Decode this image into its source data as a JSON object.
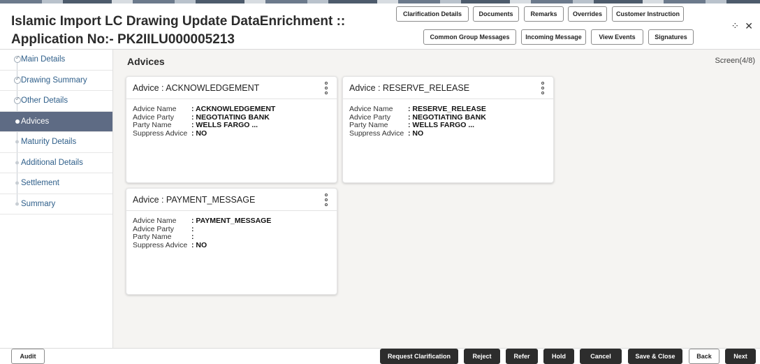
{
  "header": {
    "title_line1": "Islamic Import LC Drawing Update DataEnrichment ::",
    "title_line2": "Application No:- PK2IILU000005213",
    "buttons_row1": [
      "Clarification Details",
      "Documents",
      "Remarks",
      "Overrides",
      "Customer Instruction"
    ],
    "buttons_row2": [
      "Common Group Messages",
      "Incoming Message",
      "View Events",
      "Signatures"
    ],
    "restore_icon": "⁘",
    "close_icon": "✕"
  },
  "sidebar": {
    "items": [
      {
        "label": "Main Details",
        "state": "done"
      },
      {
        "label": "Drawing Summary",
        "state": "done"
      },
      {
        "label": "Other Details",
        "state": "done"
      },
      {
        "label": "Advices",
        "state": "active"
      },
      {
        "label": "Maturity Details",
        "state": "pending"
      },
      {
        "label": "Additional Details",
        "state": "pending"
      },
      {
        "label": "Settlement",
        "state": "pending"
      },
      {
        "label": "Summary",
        "state": "pending"
      }
    ]
  },
  "main": {
    "section_title": "Advices",
    "screen_counter": "Screen(4/8)",
    "field_labels": {
      "advice_name": "Advice Name",
      "advice_party": "Advice Party",
      "party_name": "Party Name",
      "suppress_advice": "Suppress Advice"
    },
    "cards": [
      {
        "title": "Advice : ACKNOWLEDGEMENT",
        "advice_name": ": ACKNOWLEDGEMENT",
        "advice_party": ": NEGOTIATING BANK",
        "party_name": ": WELLS FARGO ...",
        "suppress_advice": ": NO"
      },
      {
        "title": "Advice : RESERVE_RELEASE",
        "advice_name": ": RESERVE_RELEASE",
        "advice_party": ": NEGOTIATING BANK",
        "party_name": ": WELLS FARGO ...",
        "suppress_advice": ": NO"
      },
      {
        "title": "Advice : PAYMENT_MESSAGE",
        "advice_name": ": PAYMENT_MESSAGE",
        "advice_party": ":",
        "party_name": ":",
        "suppress_advice": ": NO"
      }
    ]
  },
  "footer": {
    "audit": "Audit",
    "request_clarification": "Request Clarification",
    "reject": "Reject",
    "refer": "Refer",
    "hold": "Hold",
    "cancel": "Cancel",
    "save_close": "Save & Close",
    "back": "Back",
    "next": "Next"
  },
  "colors": {
    "active_nav": "#5e6b84",
    "link_text": "#2f5f8a",
    "primary_button": "#2d2d2d"
  }
}
